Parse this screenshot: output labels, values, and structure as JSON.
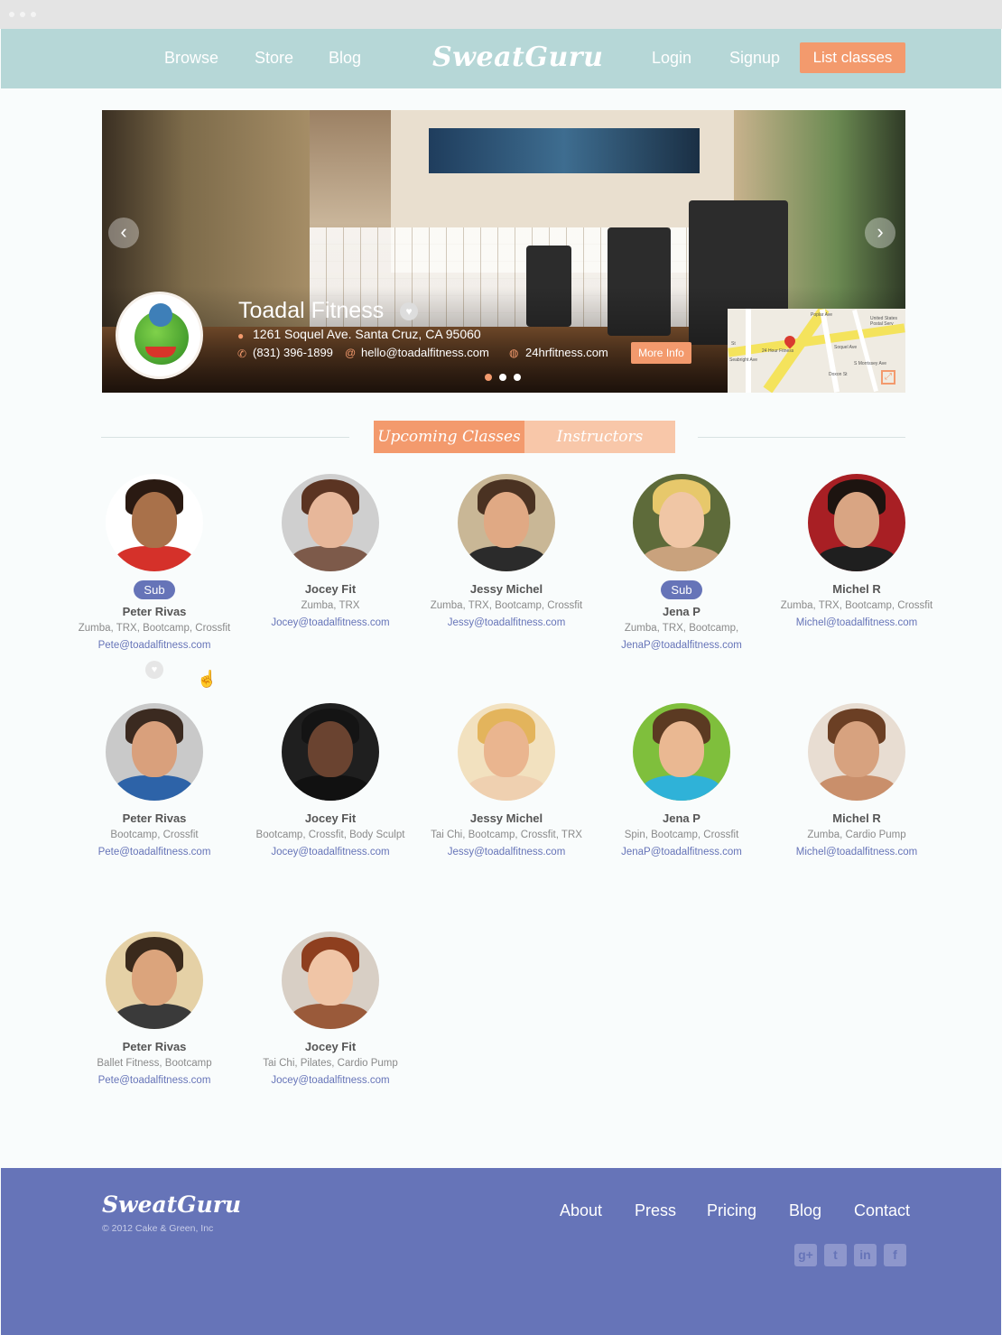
{
  "nav": {
    "browse": "Browse",
    "store": "Store",
    "blog": "Blog",
    "logo": "SweatGuru",
    "login": "Login",
    "signup": "Signup",
    "list_classes": "List classes"
  },
  "business": {
    "name": "Toadal Fitness",
    "address": "1261 Soquel Ave. Santa Cruz, CA 95060",
    "phone": "(831) 396-1899",
    "email": "hello@toadalfitness.com",
    "website": "24hrfitness.com",
    "more_info": "More Info"
  },
  "map": {
    "labels": [
      "United States Postal Serv",
      "24 Hour Fitness",
      "Soquel Ave",
      "Seabright Ave",
      "Poplar Ave",
      "Doxon St",
      "S Morrissey Ave",
      "St"
    ]
  },
  "tabs": {
    "upcoming": "Upcoming Classes",
    "instructors": "Instructors"
  },
  "sub_label": "Sub",
  "instructors": [
    {
      "name": "Peter Rivas",
      "classes": "Zumba, TRX, Bootcamp, Crossfit",
      "email": "Pete@toadalfitness.com",
      "sub": true
    },
    {
      "name": "Jocey Fit",
      "classes": "Zumba, TRX",
      "email": "Jocey@toadalfitness.com",
      "sub": false
    },
    {
      "name": "Jessy Michel",
      "classes": "Zumba, TRX, Bootcamp, Crossfit",
      "email": "Jessy@toadalfitness.com",
      "sub": false
    },
    {
      "name": "Jena P",
      "classes": "Zumba, TRX, Bootcamp,",
      "email": "JenaP@toadalfitness.com",
      "sub": true
    },
    {
      "name": "Michel R",
      "classes": "Zumba, TRX, Bootcamp, Crossfit",
      "email": "Michel@toadalfitness.com",
      "sub": false
    },
    {
      "name": "Peter Rivas",
      "classes": "Bootcamp, Crossfit",
      "email": "Pete@toadalfitness.com",
      "sub": false
    },
    {
      "name": "Jocey Fit",
      "classes": "Bootcamp, Crossfit, Body Sculpt",
      "email": "Jocey@toadalfitness.com",
      "sub": false
    },
    {
      "name": "Jessy Michel",
      "classes": "Tai Chi, Bootcamp, Crossfit, TRX",
      "email": "Jessy@toadalfitness.com",
      "sub": false
    },
    {
      "name": "Jena P",
      "classes": "Spin, Bootcamp, Crossfit",
      "email": "JenaP@toadalfitness.com",
      "sub": false
    },
    {
      "name": "Michel R",
      "classes": "Zumba, Cardio Pump",
      "email": "Michel@toadalfitness.com",
      "sub": false
    },
    {
      "name": "Peter Rivas",
      "classes": "Ballet Fitness, Bootcamp",
      "email": "Pete@toadalfitness.com",
      "sub": false
    },
    {
      "name": "Jocey Fit",
      "classes": "Tai Chi, Pilates, Cardio Pump",
      "email": "Jocey@toadalfitness.com",
      "sub": false
    }
  ],
  "footer": {
    "logo": "SweatGuru",
    "copyright": "© 2012 Cake & Green, Inc",
    "about": "About",
    "press": "Press",
    "pricing": "Pricing",
    "blog": "Blog",
    "contact": "Contact"
  },
  "social_icons": [
    "google-plus-icon",
    "twitter-icon",
    "linkedin-icon",
    "facebook-icon"
  ],
  "colors": {
    "nav_bg": "#b6d7d7",
    "accent": "#f39a6d",
    "accent_light": "#f8c7a9",
    "footer_bg": "#6674b8",
    "link": "#6674b8"
  }
}
